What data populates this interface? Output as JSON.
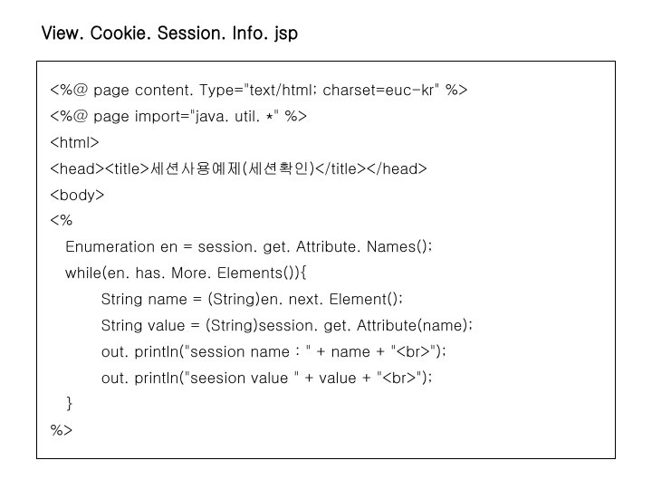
{
  "title": "View. Cookie. Session. Info. jsp",
  "code": {
    "l1": "<%@ page content. Type=\"text/html; charset=euc-kr\" %>",
    "l2": "<%@ page import=\"java. util. *\" %>",
    "l3": "<html>",
    "l4": "<head><title>세션사용예제(세션확인)</title></head>",
    "l5": "<body>",
    "l6": "<%",
    "l7": "   Enumeration en = session. get. Attribute. Names();",
    "l8": "   while(en. has. More. Elements()){",
    "l9": "          String name = (String)en. next. Element();",
    "l10": "          String value = (String)session. get. Attribute(name);",
    "l11": "          out. println(\"session name : \" + name + \"<br>\");",
    "l12": "          out. println(\"seesion value \" + value + \"<br>\");",
    "l13": "   }",
    "l14": "%>"
  }
}
